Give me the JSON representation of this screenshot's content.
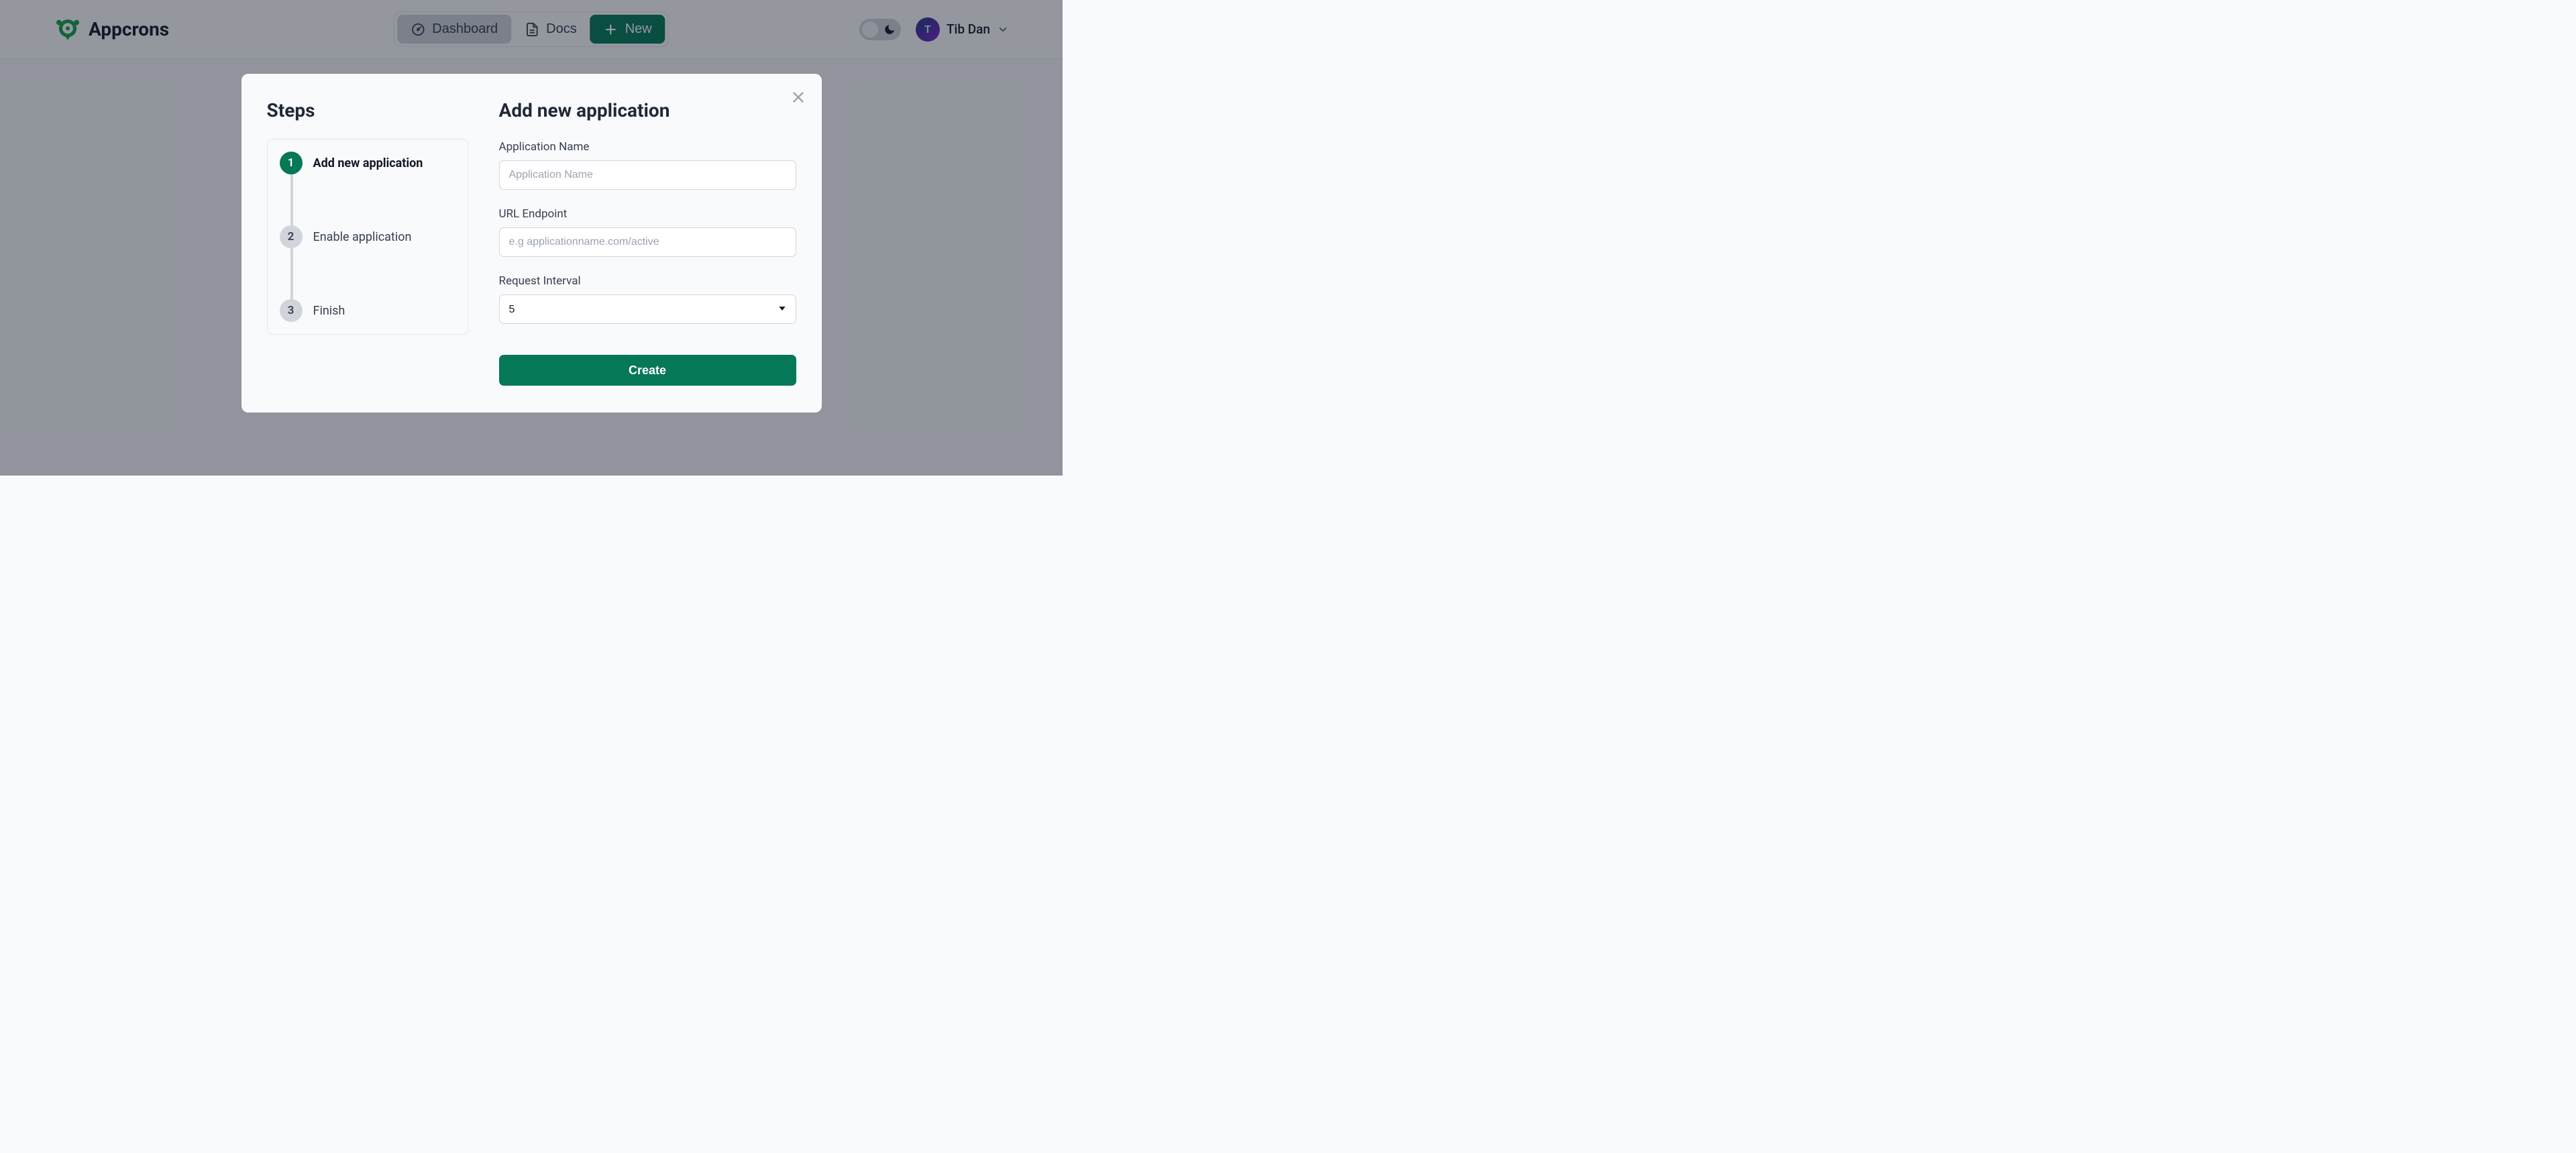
{
  "brand": {
    "name": "Appcrons"
  },
  "nav": {
    "dashboard": "Dashboard",
    "docs": "Docs",
    "new": "New"
  },
  "user": {
    "initial": "T",
    "name": "Tib Dan"
  },
  "modal": {
    "steps_title": "Steps",
    "steps": [
      {
        "num": "1",
        "label": "Add new application"
      },
      {
        "num": "2",
        "label": "Enable application"
      },
      {
        "num": "3",
        "label": "Finish"
      }
    ],
    "title": "Add new application",
    "fields": {
      "app_name": {
        "label": "Application Name",
        "placeholder": "Application Name",
        "value": ""
      },
      "url": {
        "label": "URL Endpoint",
        "placeholder": "e.g applicationname.com/active",
        "value": ""
      },
      "interval": {
        "label": "Request Interval",
        "value": "5"
      }
    },
    "submit": "Create"
  },
  "colors": {
    "primary": "#047857"
  }
}
